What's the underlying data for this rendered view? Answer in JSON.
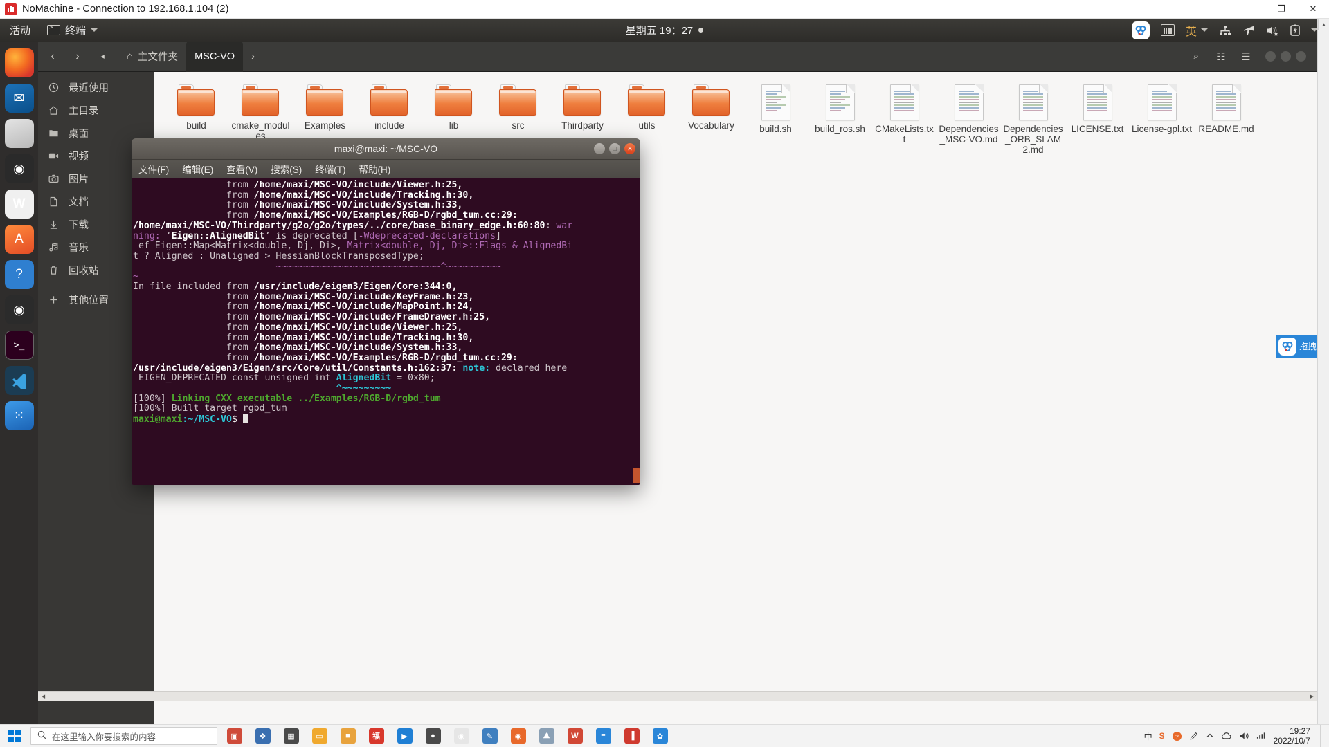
{
  "host_window": {
    "title": "NoMachine - Connection to 192.168.1.104 (2)",
    "minimize_label": "—",
    "maximize_label": "❐",
    "close_label": "✕",
    "logo_name": "nomachine-logo"
  },
  "gnome_topbar": {
    "activities": "活动",
    "app_menu": "终端",
    "clock": "星期五 19：27",
    "ime": "英",
    "indicators": [
      "nomachine-tray-icon",
      "keyboard-icon",
      "ime-indicator",
      "network-icon",
      "airplane-mode-icon",
      "volume-muted-icon",
      "battery-icon",
      "system-menu-caret"
    ]
  },
  "dock": {
    "items": [
      {
        "name": "firefox",
        "glyph": "",
        "class": "ff"
      },
      {
        "name": "thunderbird-mail",
        "glyph": "✉",
        "class": "tb"
      },
      {
        "name": "rhythmbox-files",
        "glyph": "",
        "class": "rh"
      },
      {
        "name": "software-updater",
        "glyph": "●",
        "class": "sw"
      },
      {
        "name": "libreoffice-writer",
        "glyph": "W",
        "class": "lo"
      },
      {
        "name": "ubuntu-software",
        "glyph": "A",
        "class": "am"
      },
      {
        "name": "help",
        "glyph": "?",
        "class": "hp"
      },
      {
        "name": "camera",
        "glyph": "◉",
        "class": "cam"
      },
      {
        "name": "terminal",
        "glyph": "❯_",
        "class": "trm",
        "selected": true
      },
      {
        "name": "visual-studio-code",
        "glyph": "",
        "class": "vsc"
      },
      {
        "name": "show-applications",
        "glyph": "⁙",
        "class": "blu"
      }
    ]
  },
  "files_window": {
    "breadcrumb_home": "主文件夹",
    "breadcrumb_current": "MSC-VO",
    "back_label": "‹",
    "forward_label": "›",
    "dropdown_label": "◂",
    "next_label": "›",
    "search_label": "⌕",
    "view_label": "☷",
    "menu_label": "☰",
    "sidebar": [
      {
        "label": "最近使用",
        "icon": "clock-icon"
      },
      {
        "label": "主目录",
        "icon": "home-icon"
      },
      {
        "label": "桌面",
        "icon": "folder-icon"
      },
      {
        "label": "视频",
        "icon": "video-icon"
      },
      {
        "label": "图片",
        "icon": "camera-icon"
      },
      {
        "label": "文档",
        "icon": "document-icon"
      },
      {
        "label": "下载",
        "icon": "download-icon"
      },
      {
        "label": "音乐",
        "icon": "music-icon"
      },
      {
        "label": "回收站",
        "icon": "trash-icon"
      },
      {
        "label": "其他位置",
        "icon": "plus-icon"
      }
    ],
    "items": [
      {
        "name": "build",
        "type": "folder"
      },
      {
        "name": "cmake_modules",
        "type": "folder"
      },
      {
        "name": "Examples",
        "type": "folder"
      },
      {
        "name": "include",
        "type": "folder"
      },
      {
        "name": "lib",
        "type": "folder"
      },
      {
        "name": "src",
        "type": "folder"
      },
      {
        "name": "Thirdparty",
        "type": "folder"
      },
      {
        "name": "utils",
        "type": "folder"
      },
      {
        "name": "Vocabulary",
        "type": "folder"
      },
      {
        "name": "build.sh",
        "type": "file"
      },
      {
        "name": "build_ros.sh",
        "type": "file"
      },
      {
        "name": "CMakeLists.txt",
        "type": "file"
      },
      {
        "name": "Dependencies_MSC-VO.md",
        "type": "file"
      },
      {
        "name": "Dependencies_ORB_SLAM2.md",
        "type": "file"
      },
      {
        "name": "LICENSE.txt",
        "type": "file"
      },
      {
        "name": "License-gpl.txt",
        "type": "file"
      },
      {
        "name": "README.md",
        "type": "file"
      }
    ]
  },
  "terminal": {
    "title": "maxi@maxi: ~/MSC-VO",
    "minimize_label": "–",
    "maximize_label": "□",
    "close_label": "✕",
    "menus": [
      "文件(F)",
      "编辑(E)",
      "查看(V)",
      "搜索(S)",
      "终端(T)",
      "帮助(H)"
    ],
    "lines": [
      [
        {
          "t": "                 from ",
          "c": "c-dim"
        },
        {
          "t": "/home/maxi/MSC-VO/include/Viewer.h:25,",
          "c": "c-bold"
        }
      ],
      [
        {
          "t": "                 from ",
          "c": "c-dim"
        },
        {
          "t": "/home/maxi/MSC-VO/include/Tracking.h:30,",
          "c": "c-bold"
        }
      ],
      [
        {
          "t": "                 from ",
          "c": "c-dim"
        },
        {
          "t": "/home/maxi/MSC-VO/include/System.h:33,",
          "c": "c-bold"
        }
      ],
      [
        {
          "t": "                 from ",
          "c": "c-dim"
        },
        {
          "t": "/home/maxi/MSC-VO/Examples/RGB-D/rgbd_tum.cc:29:",
          "c": "c-bold"
        }
      ],
      [
        {
          "t": "/home/maxi/MSC-VO/Thirdparty/g2o/g2o/types/../core/base_binary_edge.h:60:80: ",
          "c": "c-bold"
        },
        {
          "t": "war",
          "c": "c-mag"
        }
      ],
      [
        {
          "t": "ning:",
          "c": "c-mag"
        },
        {
          "t": " ‘",
          "c": "c-dim"
        },
        {
          "t": "Eigen::AlignedBit",
          "c": "c-bold"
        },
        {
          "t": "’ is deprecated [",
          "c": "c-dim"
        },
        {
          "t": "-Wdeprecated-declarations",
          "c": "c-mag"
        },
        {
          "t": "]",
          "c": "c-dim"
        }
      ],
      [
        {
          "t": " ef Eigen::Map<Matrix<double, Dj, Di>, ",
          "c": "c-dim"
        },
        {
          "t": "Matrix<double, Dj, Di>::Flags & AlignedBi",
          "c": "c-mag"
        }
      ],
      [
        {
          "t": "t ? Aligned : Unaligned > HessianBlockTransposedType;",
          "c": "c-dim"
        }
      ],
      [
        {
          "t": "                          ~~~~~~~~~~~~~~~~~~~~~~~~~~~~~~^~~~~~~~~~~",
          "c": "c-mag"
        }
      ],
      [
        {
          "t": "~",
          "c": "c-mag"
        }
      ],
      [
        {
          "t": "In file included from ",
          "c": "c-dim"
        },
        {
          "t": "/usr/include/eigen3/Eigen/Core:344:0,",
          "c": "c-bold"
        }
      ],
      [
        {
          "t": "                 from ",
          "c": "c-dim"
        },
        {
          "t": "/home/maxi/MSC-VO/include/KeyFrame.h:23,",
          "c": "c-bold"
        }
      ],
      [
        {
          "t": "                 from ",
          "c": "c-dim"
        },
        {
          "t": "/home/maxi/MSC-VO/include/MapPoint.h:24,",
          "c": "c-bold"
        }
      ],
      [
        {
          "t": "                 from ",
          "c": "c-dim"
        },
        {
          "t": "/home/maxi/MSC-VO/include/FrameDrawer.h:25,",
          "c": "c-bold"
        }
      ],
      [
        {
          "t": "                 from ",
          "c": "c-dim"
        },
        {
          "t": "/home/maxi/MSC-VO/include/Viewer.h:25,",
          "c": "c-bold"
        }
      ],
      [
        {
          "t": "                 from ",
          "c": "c-dim"
        },
        {
          "t": "/home/maxi/MSC-VO/include/Tracking.h:30,",
          "c": "c-bold"
        }
      ],
      [
        {
          "t": "                 from ",
          "c": "c-dim"
        },
        {
          "t": "/home/maxi/MSC-VO/include/System.h:33,",
          "c": "c-bold"
        }
      ],
      [
        {
          "t": "                 from ",
          "c": "c-dim"
        },
        {
          "t": "/home/maxi/MSC-VO/Examples/RGB-D/rgbd_tum.cc:29:",
          "c": "c-bold"
        }
      ],
      [
        {
          "t": "/usr/include/eigen3/Eigen/src/Core/util/Constants.h:162:37: ",
          "c": "c-bold"
        },
        {
          "t": "note:",
          "c": "c-cyan"
        },
        {
          "t": " declared here",
          "c": "c-dim"
        }
      ],
      [
        {
          "t": " EIGEN_DEPRECATED const unsigned int ",
          "c": "c-dim"
        },
        {
          "t": "AlignedBit",
          "c": "c-cyan"
        },
        {
          "t": " = 0x80;",
          "c": "c-dim"
        }
      ],
      [
        {
          "t": "                                     ^~~~~~~~~~",
          "c": "c-cyan"
        }
      ],
      [
        {
          "t": "",
          "c": "c-dim"
        }
      ],
      [
        {
          "t": "[100%] ",
          "c": "c-dim"
        },
        {
          "t": "Linking CXX executable ../Examples/RGB-D/rgbd_tum",
          "c": "c-green"
        }
      ],
      [
        {
          "t": "[100%] Built target rgbd_tum",
          "c": "c-dim"
        }
      ]
    ],
    "prompt": "maxi@maxi",
    "prompt_path": ":~/MSC-VO",
    "prompt_sym": "$ "
  },
  "nx_pill": {
    "label": "拖拽",
    "icon": "nomachine-icon"
  },
  "taskbar": {
    "start_label": "start-button",
    "search_placeholder": "在这里输入你要搜索的内容",
    "apps": [
      {
        "name": "task-view",
        "glyph": "▣",
        "color": "#cf4b3a"
      },
      {
        "name": "pinned-app-2",
        "glyph": "❖",
        "color": "#3a6fb0"
      },
      {
        "name": "task-view-icon",
        "glyph": "▦",
        "color": "#4a4a4a"
      },
      {
        "name": "file-explorer",
        "glyph": "▭",
        "color": "#f0a92e"
      },
      {
        "name": "store",
        "glyph": "■",
        "color": "#e8a33d"
      },
      {
        "name": "sogou-input",
        "glyph": "福",
        "color": "#d8382c"
      },
      {
        "name": "meeting-app",
        "glyph": "▶",
        "color": "#1f7fd4"
      },
      {
        "name": "media-app",
        "glyph": "●",
        "color": "#4a4a4a"
      },
      {
        "name": "chrome",
        "glyph": "◉",
        "color": "#e6e6e6"
      },
      {
        "name": "editor-app",
        "glyph": "✎",
        "color": "#3f7fbf"
      },
      {
        "name": "firefox-task",
        "glyph": "◉",
        "color": "#e8692b"
      },
      {
        "name": "photo-app",
        "glyph": "⛰",
        "color": "#8aa0b5"
      },
      {
        "name": "wps-writer",
        "glyph": "W",
        "color": "#d14836"
      },
      {
        "name": "tool-app",
        "glyph": "≡",
        "color": "#2a86d8"
      },
      {
        "name": "chart-app",
        "glyph": "▐",
        "color": "#cf3a2f"
      },
      {
        "name": "nomachine-task",
        "glyph": "✿",
        "color": "#2a86d8"
      }
    ],
    "tray": {
      "ime_mode": "中",
      "sogou": "S",
      "icons": [
        "help-circle-icon",
        "pen-icon",
        "chevron-up-icon",
        "cloud-icon",
        "volume-icon",
        "network-icon"
      ],
      "time": "19:27",
      "date": "2022/10/7"
    }
  }
}
